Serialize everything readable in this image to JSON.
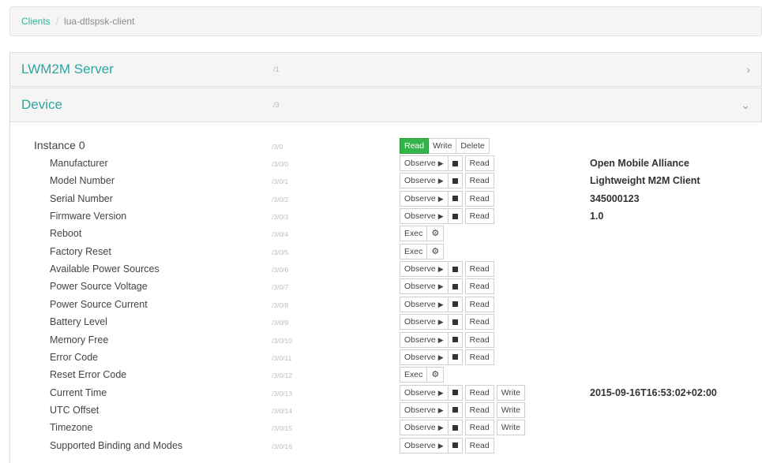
{
  "breadcrumb": {
    "root": "Clients",
    "current": "lua-dtlspsk-client"
  },
  "panels": [
    {
      "title": "LWM2M Server",
      "path": "/1",
      "chevron": "chevron-right-icon"
    },
    {
      "title": "Device",
      "path": "/3",
      "chevron": "chevron-down-icon"
    }
  ],
  "labels": {
    "read": "Read",
    "write": "Write",
    "delete": "Delete",
    "observe": "Observe",
    "exec": "Exec"
  },
  "instance": {
    "name": "Instance 0",
    "path": "/3/0"
  },
  "resources": [
    {
      "name": "Manufacturer",
      "path": "/3/0/0",
      "type": "observe",
      "write": false,
      "value": "Open Mobile Alliance"
    },
    {
      "name": "Model Number",
      "path": "/3/0/1",
      "type": "observe",
      "write": false,
      "value": "Lightweight M2M Client"
    },
    {
      "name": "Serial Number",
      "path": "/3/0/2",
      "type": "observe",
      "write": false,
      "value": "345000123"
    },
    {
      "name": "Firmware Version",
      "path": "/3/0/3",
      "type": "observe",
      "write": false,
      "value": "1.0"
    },
    {
      "name": "Reboot",
      "path": "/3/0/4",
      "type": "exec",
      "write": false,
      "value": ""
    },
    {
      "name": "Factory Reset",
      "path": "/3/0/5",
      "type": "exec",
      "write": false,
      "value": ""
    },
    {
      "name": "Available Power Sources",
      "path": "/3/0/6",
      "type": "observe",
      "write": false,
      "value": ""
    },
    {
      "name": "Power Source Voltage",
      "path": "/3/0/7",
      "type": "observe",
      "write": false,
      "value": ""
    },
    {
      "name": "Power Source Current",
      "path": "/3/0/8",
      "type": "observe",
      "write": false,
      "value": ""
    },
    {
      "name": "Battery Level",
      "path": "/3/0/9",
      "type": "observe",
      "write": false,
      "value": ""
    },
    {
      "name": "Memory Free",
      "path": "/3/0/10",
      "type": "observe",
      "write": false,
      "value": ""
    },
    {
      "name": "Error Code",
      "path": "/3/0/11",
      "type": "observe",
      "write": false,
      "value": ""
    },
    {
      "name": "Reset Error Code",
      "path": "/3/0/12",
      "type": "exec",
      "write": false,
      "value": ""
    },
    {
      "name": "Current Time",
      "path": "/3/0/13",
      "type": "observe",
      "write": true,
      "value": "2015-09-16T16:53:02+02:00"
    },
    {
      "name": "UTC Offset",
      "path": "/3/0/14",
      "type": "observe",
      "write": true,
      "value": ""
    },
    {
      "name": "Timezone",
      "path": "/3/0/15",
      "type": "observe",
      "write": true,
      "value": ""
    },
    {
      "name": "Supported Binding and Modes",
      "path": "/3/0/16",
      "type": "observe",
      "write": false,
      "value": ""
    }
  ],
  "colors": {
    "accent": "#2aa7a0",
    "read_active": "#35b44a"
  }
}
